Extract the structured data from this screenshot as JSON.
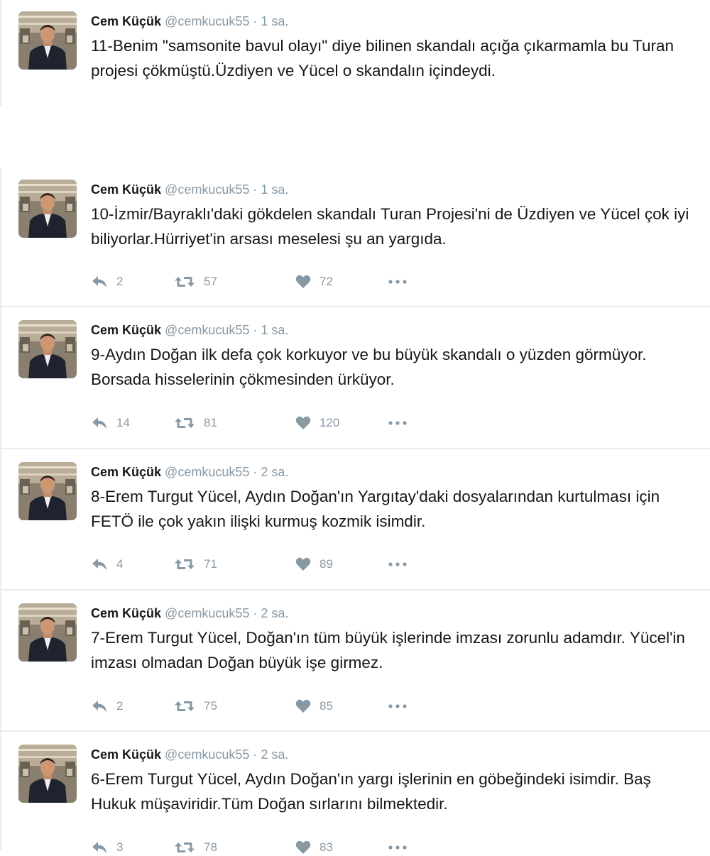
{
  "tweets": [
    {
      "name": "Cem Küçük",
      "handle": "@cemkucuk55",
      "time": "1 sa.",
      "text": "11-Benim \"samsonite bavul olayı\" diye bilinen skandalı açığa çıkarmamla bu Turan projesi çökmüştü.Üzdiyen ve Yücel o skandalın içindeydi."
    },
    {
      "name": "Cem Küçük",
      "handle": "@cemkucuk55",
      "time": "1 sa.",
      "text": "10-İzmir/Bayraklı'daki gökdelen skandalı Turan Projesi'ni de Üzdiyen ve Yücel çok iyi biliyorlar.Hürriyet'in arsası meselesi şu an yargıda.",
      "replies": "2",
      "retweets": "57",
      "likes": "72"
    },
    {
      "name": "Cem Küçük",
      "handle": "@cemkucuk55",
      "time": "1 sa.",
      "text": "9-Aydın Doğan ilk defa çok korkuyor ve bu büyük skandalı o yüzden görmüyor. Borsada hisselerinin çökmesinden ürküyor.",
      "replies": "14",
      "retweets": "81",
      "likes": "120"
    },
    {
      "name": "Cem Küçük",
      "handle": "@cemkucuk55",
      "time": "2 sa.",
      "text": "8-Erem Turgut Yücel, Aydın Doğan'ın Yargıtay'daki dosyalarından kurtulması için FETÖ ile çok yakın ilişki kurmuş kozmik isimdir.",
      "replies": "4",
      "retweets": "71",
      "likes": "89"
    },
    {
      "name": "Cem Küçük",
      "handle": "@cemkucuk55",
      "time": "2 sa.",
      "text": "7-Erem Turgut Yücel, Doğan'ın tüm büyük işlerinde imzası zorunlu adamdır. Yücel'in imzası olmadan Doğan büyük işe girmez.",
      "replies": "2",
      "retweets": "75",
      "likes": "85"
    },
    {
      "name": "Cem Küçük",
      "handle": "@cemkucuk55",
      "time": "2 sa.",
      "text": "6-Erem Turgut Yücel, Aydın Doğan'ın yargı işlerinin en göbeğindeki isimdir. Baş Hukuk müşaviridir.Tüm Doğan sırlarını bilmektedir.",
      "replies": "3",
      "retweets": "78",
      "likes": "83"
    }
  ],
  "separator": "·",
  "icons": {
    "reply": "reply-icon",
    "retweet": "retweet-icon",
    "like": "heart-icon",
    "more": "more-icon"
  },
  "colors": {
    "text": "#14171a",
    "muted": "#8899a6",
    "divider": "#e6ecf0"
  }
}
